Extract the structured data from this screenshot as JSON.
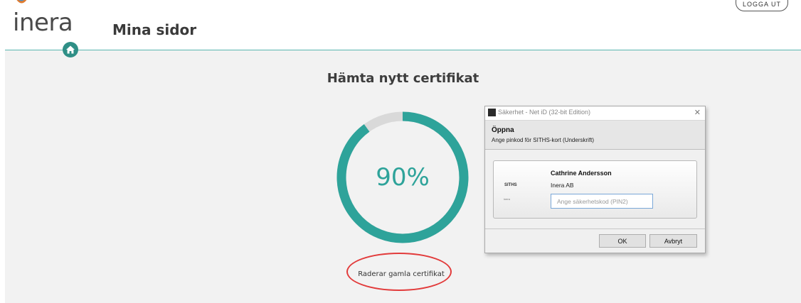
{
  "header": {
    "logo_text": "inera",
    "site_title": "Mina sidor",
    "logout_label": "LOGGA UT"
  },
  "main": {
    "heading": "Hämta nytt certifikat",
    "progress": {
      "value": 0.9,
      "label": "90%"
    },
    "status_text": "Raderar gamla certifikat"
  },
  "dialog": {
    "title": "Säkerhet - Net iD (32-bit Edition)",
    "heading": "Öppna",
    "instruction": "Ange pinkod för SITHS-kort (Underskrift)",
    "card": {
      "logo_text": "SITHS",
      "logo_subtext": "inera",
      "name": "Cathrine Andersson",
      "organization": "Inera AB",
      "pin_placeholder": "Ange säkerhetskod (PIN2)",
      "pin_value": ""
    },
    "ok_label": "OK",
    "cancel_label": "Avbryt"
  },
  "colors": {
    "accent": "#2ea39a",
    "track": "#d9d9d9",
    "annotation": "#e23b3b",
    "background": "#f2f2f2"
  },
  "icons": {
    "home": "home-icon",
    "close": "close-icon",
    "app": "netid-app-icon"
  }
}
